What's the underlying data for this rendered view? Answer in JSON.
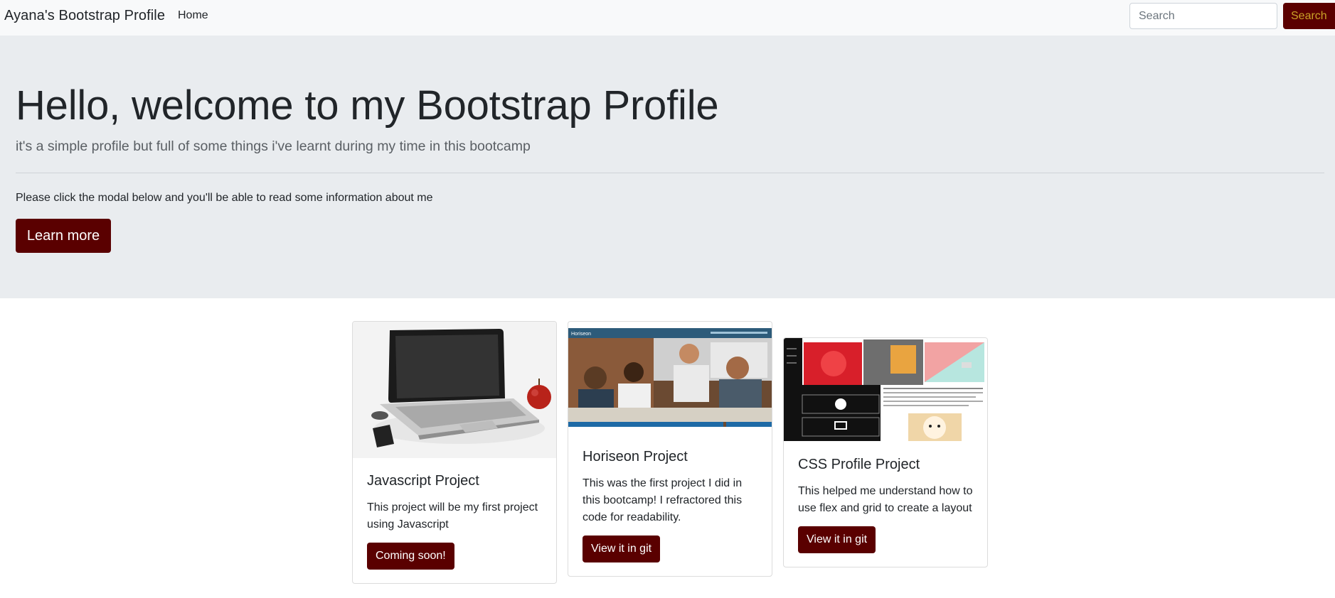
{
  "navbar": {
    "brand": "Ayana's Bootstrap Profile",
    "home_link": "Home",
    "search_placeholder": "Search",
    "search_button": "Search"
  },
  "jumbotron": {
    "title": "Hello, welcome to my Bootstrap Profile",
    "lead": "it's a simple profile but full of some things i've learnt during my time in this bootcamp",
    "info": "Please click the modal below and you'll be able to read some information about me",
    "button": "Learn more"
  },
  "cards": [
    {
      "title": "Javascript Project",
      "text": "This project will be my first project using Javascript",
      "button": "Coming soon!",
      "image_icon": "laptop-image"
    },
    {
      "title": "Horiseon Project",
      "text": "This was the first project I did in this bootcamp! I refractored this code for readability.",
      "button": "View it in git",
      "image_icon": "horiseon-screenshot-image",
      "image_caption": "Horiseon"
    },
    {
      "title": "CSS Profile Project",
      "text": "This helped me understand how to use flex and grid to create a layout",
      "button": "View it in git",
      "image_icon": "css-profile-screenshot-image"
    }
  ],
  "colors": {
    "accent": "#5a0000",
    "search_text": "#c9a227",
    "jumbotron_bg": "#e9ecef",
    "navbar_bg": "#f8f9fa"
  }
}
